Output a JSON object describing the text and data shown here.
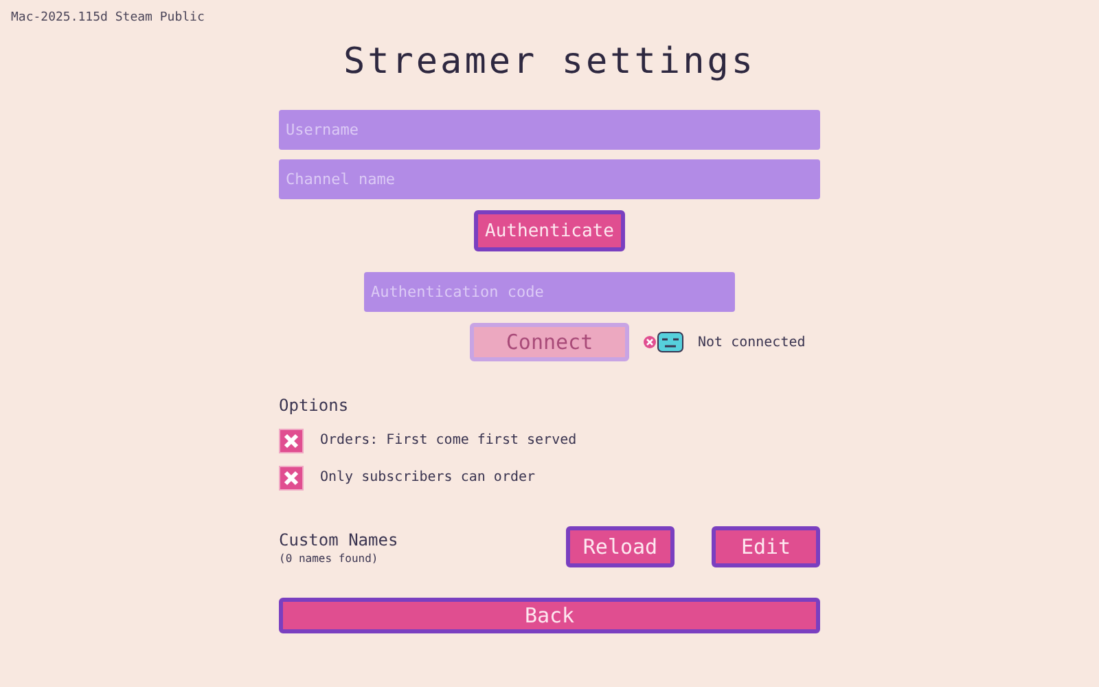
{
  "version": "Mac-2025.115d Steam Public",
  "title": "Streamer settings",
  "fields": [
    {
      "placeholder": "Username"
    },
    {
      "placeholder": "Channel name"
    }
  ],
  "authenticate_button": {
    "label": "Authenticate"
  },
  "code_field": {
    "placeholder": "Authentication code"
  },
  "connect_button": {
    "label": "Connect",
    "disabled": true
  },
  "status": {
    "connected": false,
    "text": "Not connected"
  },
  "options": {
    "heading": "Options",
    "items": [
      {
        "label": "Orders: First come first served",
        "checked": true
      },
      {
        "label": "Only subscribers can order",
        "checked": true
      }
    ]
  },
  "custom_names": {
    "heading": "Custom Names",
    "count": "(0 names found)",
    "buttons": [
      {
        "label": "Reload"
      },
      {
        "label": "Edit"
      }
    ]
  },
  "back_button": {
    "label": "Back"
  }
}
